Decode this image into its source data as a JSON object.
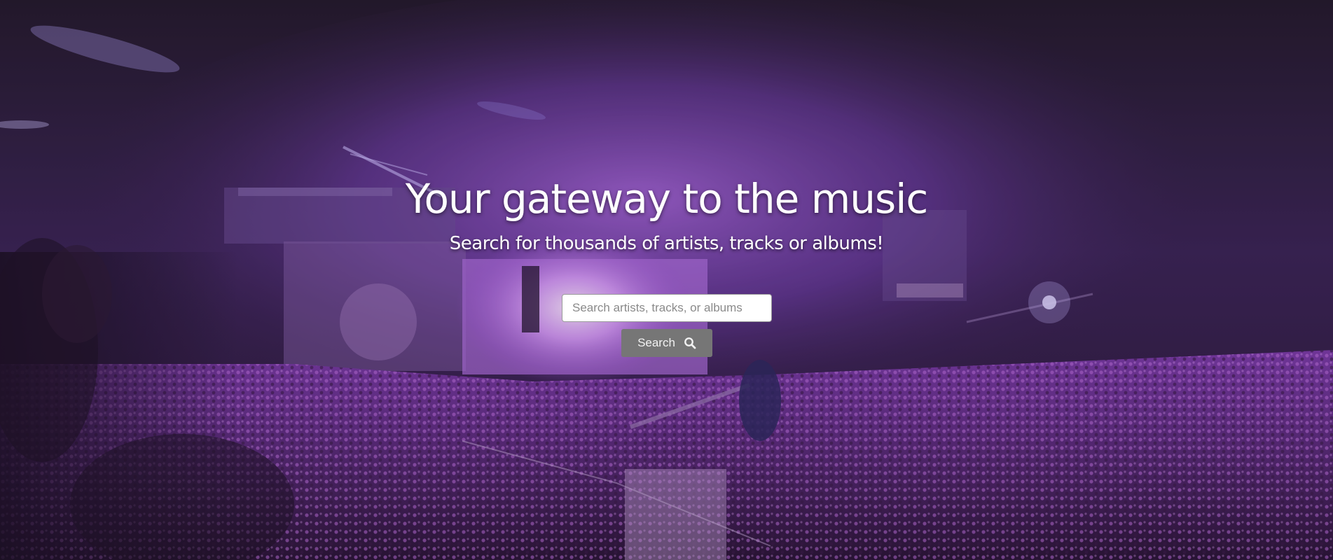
{
  "hero": {
    "title": "Your gateway to the music",
    "subtitle": "Search for thousands of artists, tracks or albums!",
    "background_image": "concert-crowd-stage-purple-lights"
  },
  "search": {
    "placeholder": "Search artists, tracks, or albums",
    "value": "",
    "button_label": "Search",
    "button_icon": "search-icon"
  },
  "colors": {
    "overlay_purple": "#7a3fb8",
    "button_bg": "#767676",
    "text": "#ffffff"
  }
}
